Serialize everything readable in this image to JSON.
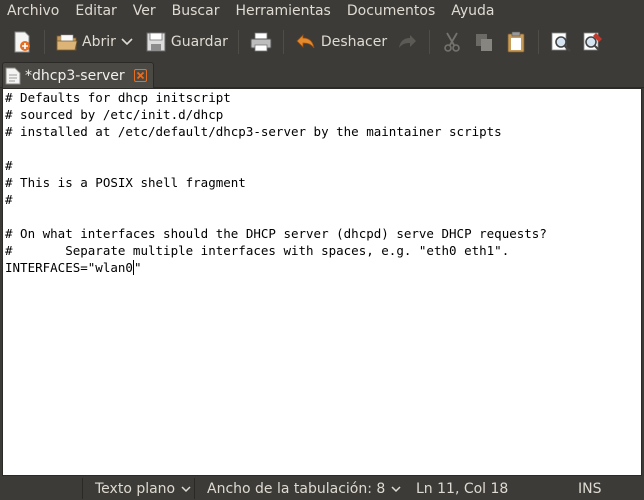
{
  "menu": [
    "Archivo",
    "Editar",
    "Ver",
    "Buscar",
    "Herramientas",
    "Documentos",
    "Ayuda"
  ],
  "toolbar": {
    "open_label": "Abrir",
    "save_label": "Guardar",
    "undo_label": "Deshacer"
  },
  "tab": {
    "title": "*dhcp3-server"
  },
  "editor": {
    "lines": [
      "# Defaults for dhcp initscript",
      "# sourced by /etc/init.d/dhcp",
      "# installed at /etc/default/dhcp3-server by the maintainer scripts",
      "",
      "#",
      "# This is a POSIX shell fragment",
      "#",
      "",
      "# On what interfaces should the DHCP server (dhcpd) serve DHCP requests?",
      "#       Separate multiple interfaces with spaces, e.g. \"eth0 eth1\".",
      "INTERFACES=\"wlan0"
    ],
    "cursor_tail": "\""
  },
  "statusbar": {
    "language": "Texto plano",
    "tab_width": "Ancho de la tabulación:  8",
    "position": "Ln 11, Col 18",
    "mode": "INS"
  },
  "colors": {
    "chrome": "#3c3b37",
    "text_light": "#dfdbd2",
    "editor_bg": "#ffffff",
    "close_orange": "#e46f24",
    "undo_orange": "#e5892d"
  }
}
